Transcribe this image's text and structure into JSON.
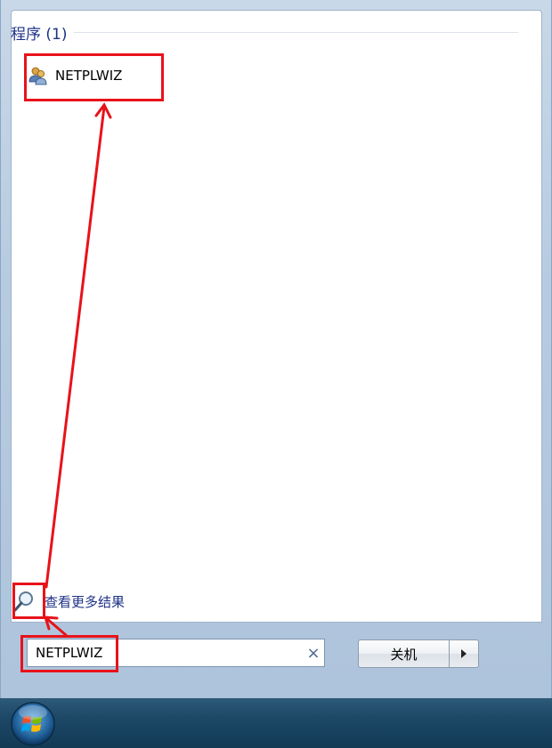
{
  "results": {
    "header": "程序 (1)",
    "items": [
      {
        "label": "NETPLWIZ",
        "icon": "users-icon"
      }
    ]
  },
  "see_more": {
    "label": "查看更多结果",
    "icon": "search-icon"
  },
  "search": {
    "value": "NETPLWIZ",
    "clear_icon": "×"
  },
  "shutdown": {
    "label": "关机",
    "arrow_icon": "chevron-right-icon"
  },
  "colors": {
    "annotation": "#e8121a",
    "header_text": "#1e3287",
    "taskbar": "#1c4866"
  }
}
